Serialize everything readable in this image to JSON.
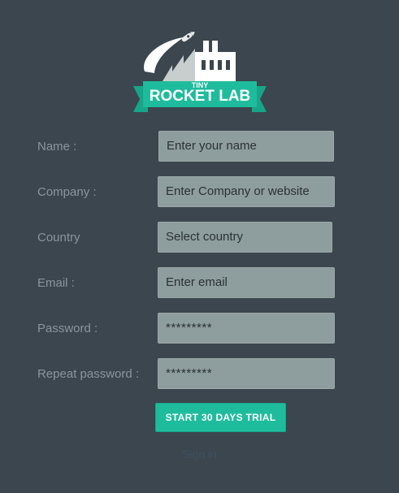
{
  "logo": {
    "small_text": "TINY",
    "large_text": "ROCKET LAB"
  },
  "form": {
    "fields": [
      {
        "label": "Name :",
        "value": "Enter your name"
      },
      {
        "label": "Company :",
        "value": "Enter Company or website"
      },
      {
        "label": "Country",
        "value": "Select country"
      },
      {
        "label": "Email :",
        "value": "Enter email"
      },
      {
        "label": "Password :",
        "value": "*********"
      },
      {
        "label": "Repeat password :",
        "value": "*********"
      }
    ],
    "submit_label": "START 30 DAYS TRIAL",
    "signin_label": "Sign in"
  },
  "colors": {
    "background": "#3b464e",
    "field_background": "#8e9d9d",
    "accent": "#1ebc9c",
    "label_text": "#8b959b"
  }
}
